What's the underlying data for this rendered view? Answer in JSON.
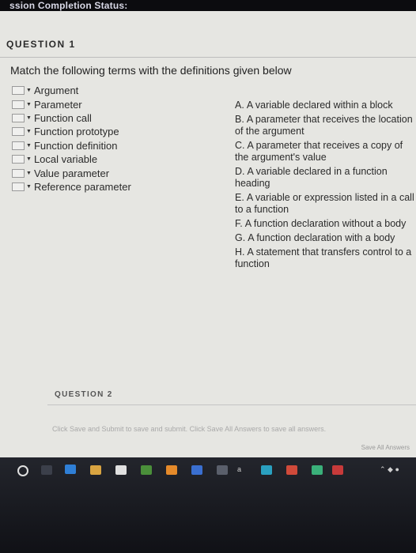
{
  "header": {
    "status_text": "ssion Completion Status:"
  },
  "question1": {
    "header": "QUESTION 1",
    "instructions": "Match the following terms with the definitions given below",
    "terms": [
      "Argument",
      "Parameter",
      "Function call",
      "Function prototype",
      "Function definition",
      "Local variable",
      "Value parameter",
      "Reference parameter"
    ],
    "selected_value": "",
    "definitions": [
      {
        "letter": "A.",
        "text": "A variable declared within a block"
      },
      {
        "letter": "B.",
        "text": "A parameter that receives the location of the argument"
      },
      {
        "letter": "C.",
        "text": "A parameter that receives a copy of the argument's value"
      },
      {
        "letter": "D.",
        "text": "A variable declared in a function heading"
      },
      {
        "letter": "E.",
        "text": "A variable or expression listed in a call to a function"
      },
      {
        "letter": "F.",
        "text": "A function declaration without a body"
      },
      {
        "letter": "G.",
        "text": "A function declaration with a body"
      },
      {
        "letter": "H.",
        "text": "A statement that transfers control to a function"
      }
    ]
  },
  "question2": {
    "header": "QUESTION 2"
  },
  "footer": {
    "instruction_text": "Click Save and Submit to save and submit. Click Save All Answers to save all answers.",
    "save_all_label": "Save All Answers"
  },
  "taskbar": {
    "a_label": "a",
    "colors": {
      "panel": "#e6e6e2",
      "taskbar": "#15161b"
    }
  }
}
